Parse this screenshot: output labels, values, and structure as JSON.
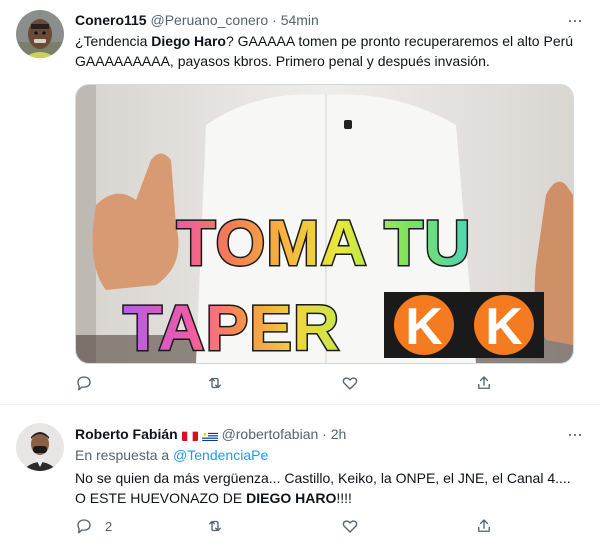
{
  "tweet1": {
    "author_name": "Conero115",
    "handle": "@Peruano_conero",
    "separator": " · ",
    "time": "54min",
    "text_before": "¿Tendencia ",
    "text_bold": "Diego Haro",
    "text_after": "? GAAAAA tomen pe pronto recuperaremos el alto Perú GAAAAAAAAA, payasos kbros. Primero penal y después invasión.",
    "more_icon": "more-dots-icon",
    "media": {
      "line1": "TOMA TU",
      "line2": "TAPER",
      "logo_letter": "K"
    },
    "actions": {
      "reply_count": "",
      "retweet_count": "",
      "like_count": ""
    }
  },
  "tweet2": {
    "author_name": "Roberto Fabián",
    "handle": "@robertofabian",
    "separator": " · ",
    "time": "2h",
    "reply_prefix": "En respuesta a ",
    "reply_handle": "@TendenciaPe",
    "line1": "No se quien da más vergüenza... Castillo, Keiko, la ONPE, el JNE, el Canal 4....",
    "line2_before": "O ESTE HUEVONAZO DE ",
    "line2_bold": "DIEGO HARO",
    "line2_after": "!!!!",
    "more_icon": "more-dots-icon",
    "flags": [
      "peru-flag",
      "uruguay-flag"
    ],
    "actions": {
      "reply_count": "2",
      "retweet_count": "",
      "like_count": ""
    }
  },
  "colors": {
    "text": "#0f1419",
    "secondary": "#536471",
    "link": "#1d9bf0",
    "divider": "#eff3f4",
    "keiko_orange": "#f47b20"
  }
}
